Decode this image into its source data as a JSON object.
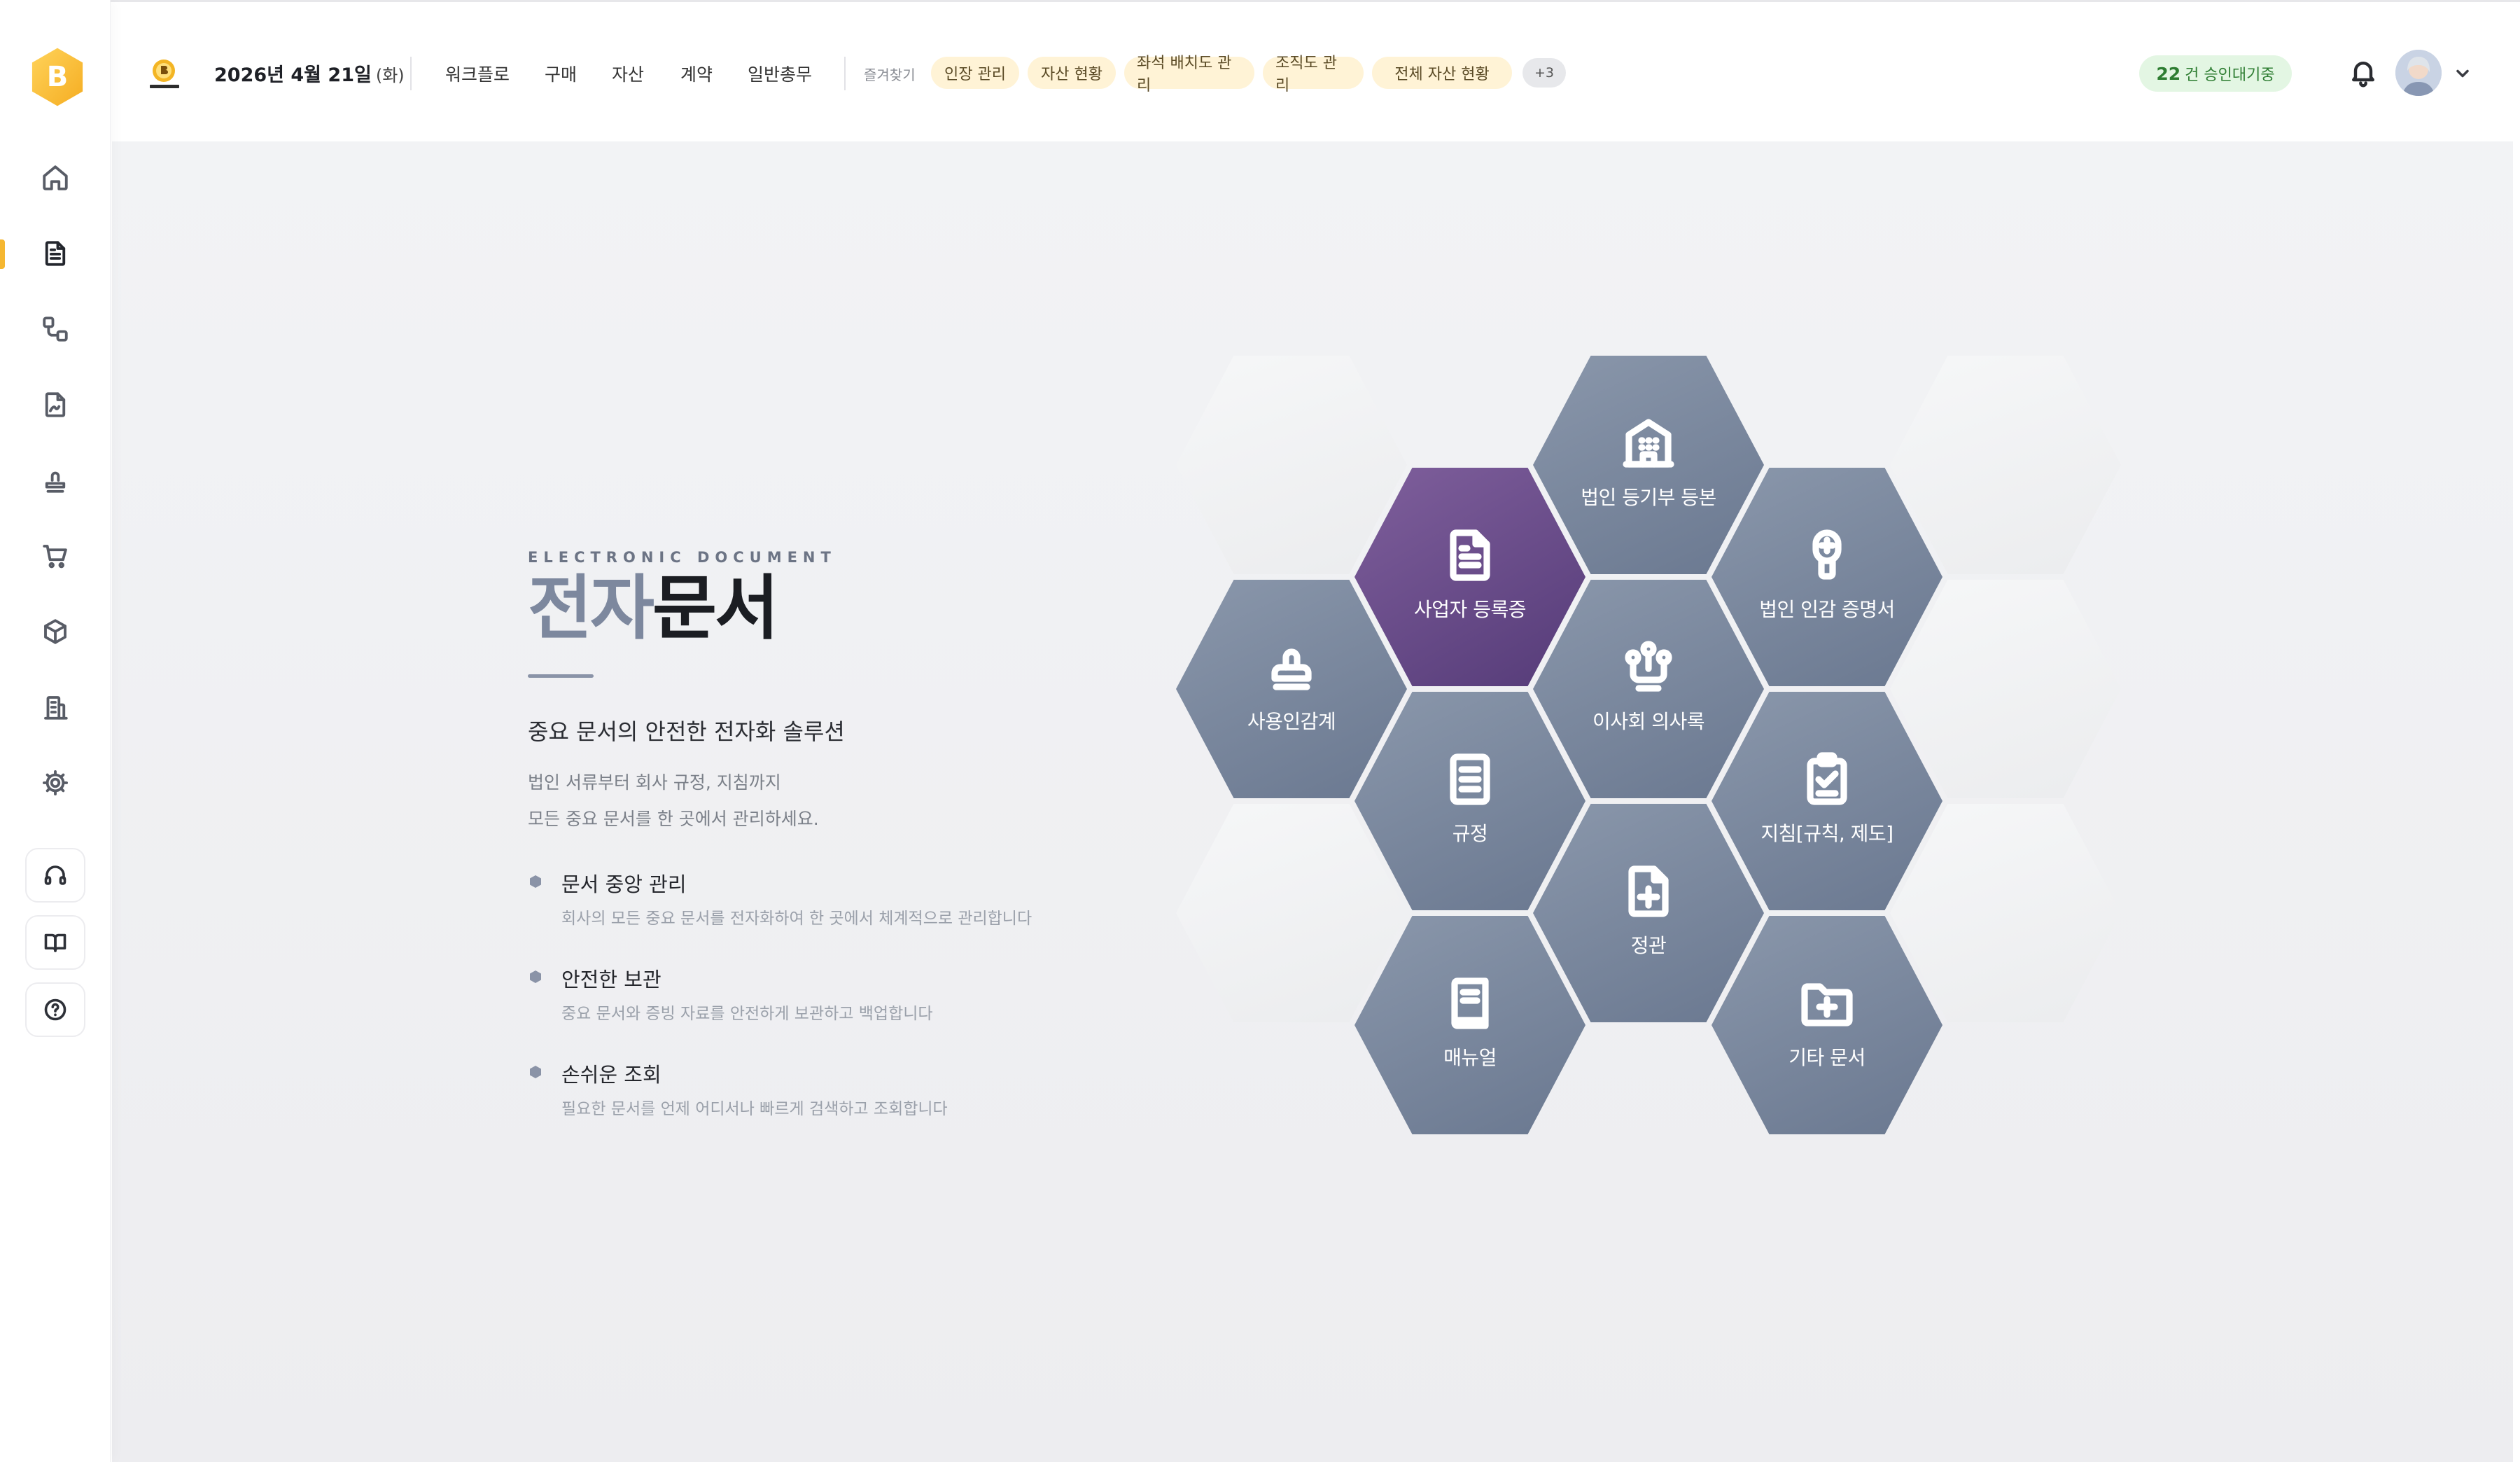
{
  "brand": {
    "logo_letter": "B"
  },
  "sidebar": {
    "items": [
      {
        "name": "home",
        "icon": "home-icon"
      },
      {
        "name": "documents",
        "icon": "document-icon",
        "active": true
      },
      {
        "name": "workflow",
        "icon": "workflow-icon"
      },
      {
        "name": "contract",
        "icon": "signature-document-icon"
      },
      {
        "name": "seal",
        "icon": "stamp-icon"
      },
      {
        "name": "purchase",
        "icon": "cart-icon"
      },
      {
        "name": "asset",
        "icon": "box-icon"
      },
      {
        "name": "organization",
        "icon": "building-icon"
      },
      {
        "name": "settings",
        "icon": "gear-icon"
      }
    ],
    "utilities": [
      {
        "name": "support",
        "icon": "headset-icon"
      },
      {
        "name": "guide",
        "icon": "book-icon"
      },
      {
        "name": "help",
        "icon": "question-icon"
      }
    ],
    "accent_color": "#f5b731"
  },
  "header": {
    "date": "2026년 4월 21일",
    "day_of_week": "(화)",
    "menu": [
      "워크플로",
      "구매",
      "자산",
      "계약",
      "일반총무"
    ],
    "favorites_label": "즐겨찾기",
    "favorites": [
      "인장 관리",
      "자산 현황",
      "좌석 배치도 관리",
      "조직도 관리",
      "전체 자산 현황"
    ],
    "favorites_more": "+3",
    "approval": {
      "count": "22",
      "label": "건 승인대기중",
      "color": "#2e7d32"
    }
  },
  "intro": {
    "eyebrow": "ELECTRONIC DOCUMENT",
    "title_accent": "전자",
    "title_main": "문서",
    "subtitle": "중요 문서의 안전한 전자화 솔루션",
    "desc_line1": "법인 서류부터 회사 규정, 지침까지",
    "desc_line2": "모든 중요 문서를 한 곳에서 관리하세요.",
    "features": [
      {
        "title": "문서 중앙 관리",
        "desc": "회사의 모든 중요 문서를 전자화하여 한 곳에서 체계적으로 관리합니다"
      },
      {
        "title": "안전한 보관",
        "desc": "중요 문서와 증빙 자료를 안전하게 보관하고 백업합니다"
      },
      {
        "title": "손쉬운 조회",
        "desc": "필요한 문서를 언제 어디서나 빠르게 검색하고 조회합니다"
      }
    ]
  },
  "categories": {
    "active_color": "#5f4584",
    "tile_color": "#7a869b",
    "items": [
      {
        "label": "법인 등기부 등본",
        "icon": "building-icon"
      },
      {
        "label": "사업자 등록증",
        "icon": "document-icon",
        "active": true
      },
      {
        "label": "법인 인감 증명서",
        "icon": "certificate-seal-icon"
      },
      {
        "label": "사용인감계",
        "icon": "stamp-icon"
      },
      {
        "label": "이사회 의사록",
        "icon": "board-people-icon"
      },
      {
        "label": "규정",
        "icon": "regulation-list-icon"
      },
      {
        "label": "지침[규칙, 제도]",
        "icon": "clipboard-check-icon"
      },
      {
        "label": "정관",
        "icon": "file-plus-icon"
      },
      {
        "label": "매뉴얼",
        "icon": "manual-book-icon"
      },
      {
        "label": "기타 문서",
        "icon": "folder-plus-icon"
      }
    ]
  }
}
